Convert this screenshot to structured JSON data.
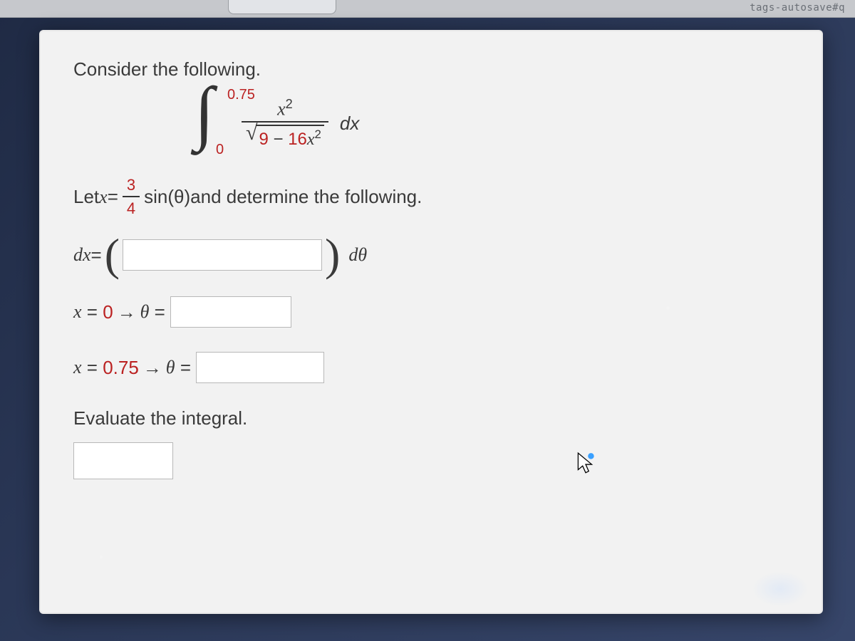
{
  "chrome": {
    "url_fragment": "tags-autosave#q"
  },
  "problem": {
    "intro": "Consider the following.",
    "integral": {
      "lower": "0",
      "upper": "0.75",
      "numerator_base": "x",
      "numerator_exp": "2",
      "radicand_a": "9",
      "radicand_op": "−",
      "radicand_b_coeff": "16",
      "radicand_b_base": "x",
      "radicand_b_exp": "2",
      "dx": "dx"
    },
    "substitution": {
      "lead": "Let ",
      "lhs_var": "x",
      "eq": " = ",
      "frac_num": "3",
      "frac_den": "4",
      "trig": " sin(θ) ",
      "tail": "and determine the following."
    },
    "dx_row": {
      "lhs": "dx",
      "eq": " = ",
      "rhs_unit": "dθ"
    },
    "limit1": {
      "x_label": "x",
      "x_val": "0",
      "arrow": "→",
      "theta_label": "θ",
      "eq": "="
    },
    "limit2": {
      "x_label": "x",
      "x_val": "0.75",
      "arrow": "→",
      "theta_label": "θ",
      "eq": "="
    },
    "evaluate": "Evaluate the integral."
  }
}
